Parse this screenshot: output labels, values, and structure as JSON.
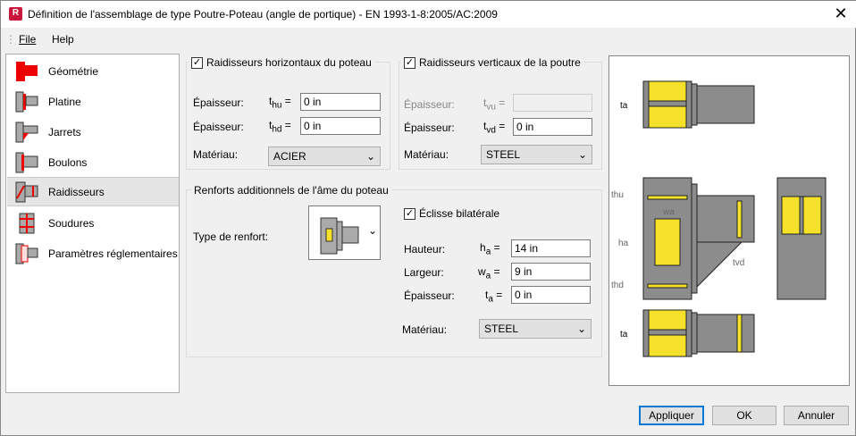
{
  "window": {
    "title": "Définition de l'assemblage de type Poutre-Poteau (angle de portique) - EN 1993-1-8:2005/AC:2009",
    "app_icon": "R",
    "close": "✕"
  },
  "menu": {
    "file": "File",
    "help": "Help"
  },
  "sidebar": {
    "items": [
      {
        "label": "Géométrie",
        "icon": "geometry-icon"
      },
      {
        "label": "Platine",
        "icon": "plate-icon"
      },
      {
        "label": "Jarrets",
        "icon": "haunch-icon"
      },
      {
        "label": "Boulons",
        "icon": "bolts-icon"
      },
      {
        "label": "Raidisseurs",
        "icon": "stiffeners-icon",
        "selected": true
      },
      {
        "label": "Soudures",
        "icon": "welds-icon"
      },
      {
        "label": "Paramètres réglementaires",
        "icon": "code-params-icon"
      }
    ]
  },
  "horiz": {
    "label": "Raidisseurs horizontaux du poteau",
    "checked": true,
    "r1": {
      "label": "Épaisseur:",
      "sym": "t",
      "sub": "hu",
      "value": "0 in"
    },
    "r2": {
      "label": "Épaisseur:",
      "sym": "t",
      "sub": "hd",
      "value": "0 in"
    },
    "mat": {
      "label": "Matériau:",
      "value": "ACIER"
    }
  },
  "vert": {
    "label": "Raidisseurs verticaux de la poutre",
    "checked": true,
    "r1": {
      "label": "Épaisseur:",
      "sym": "t",
      "sub": "vu",
      "value": ""
    },
    "r2": {
      "label": "Épaisseur:",
      "sym": "t",
      "sub": "vd",
      "value": "0 in"
    },
    "mat": {
      "label": "Matériau:",
      "value": "STEEL"
    }
  },
  "renforts": {
    "label": "Renforts additionnels de l'âme du poteau",
    "type_label": "Type de renfort:",
    "eclisse": {
      "label": "Éclisse bilatérale",
      "checked": true
    },
    "h": {
      "label": "Hauteur:",
      "sym": "h",
      "sub": "a",
      "value": "14 in"
    },
    "w": {
      "label": "Largeur:",
      "sym": "w",
      "sub": "a",
      "value": "9 in"
    },
    "t": {
      "label": "Épaisseur:",
      "sym": "t",
      "sub": "a",
      "value": "0 in"
    },
    "mat": {
      "label": "Matériau:",
      "value": "STEEL"
    }
  },
  "preview": {
    "labels": {
      "ta": "ta",
      "thu": "thu",
      "thd": "thd",
      "ha": "ha",
      "wa": "wa",
      "tvd": "tvd"
    }
  },
  "buttons": {
    "apply": "Appliquer",
    "ok": "OK",
    "cancel": "Annuler"
  },
  "colors": {
    "stiffener": "#f5e12a",
    "steel": "#8c8c8c",
    "accent": "#0078d7",
    "active_part": "#e00000"
  }
}
